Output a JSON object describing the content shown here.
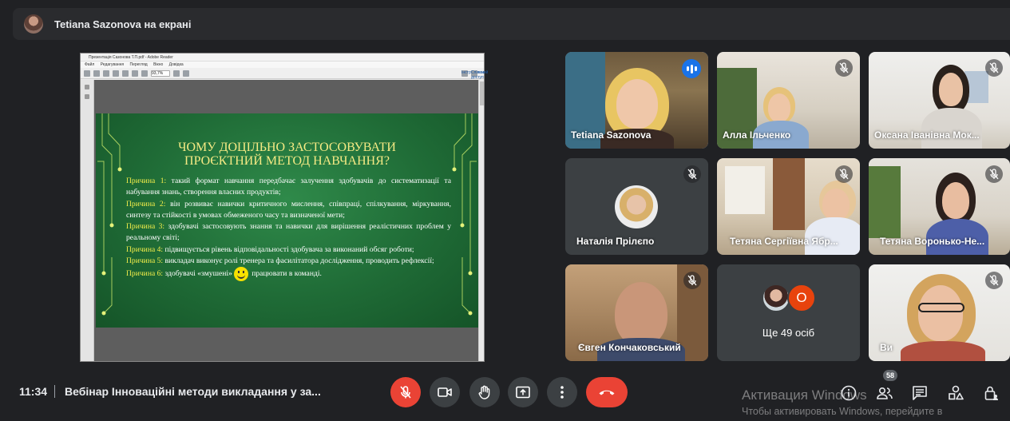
{
  "top_bar": {
    "presenter_title": "Tetiana Sazonova на екрані"
  },
  "shared_screen": {
    "window_title": "Презентація Сазонова Т.П.pdf - Adobe Reader",
    "menu": [
      "Файл",
      "Редагування",
      "Перегляд",
      "Вікно",
      "Довідка"
    ],
    "zoom": "93,7%",
    "toolbar_right": [
      "Інструменти",
      "Спільний доступ"
    ],
    "slide": {
      "title_line1": "ЧОМУ ДОЦІЛЬНО ЗАСТОСОВУВАТИ",
      "title_line2": "ПРОЄКТНИЙ МЕТОД НАВЧАННЯ?",
      "reasons": [
        {
          "label": "Причина 1:",
          "text": " такий формат навчання передбачає залучення здобувачів до систематизації та набування знань, створення власних продуктів;"
        },
        {
          "label": "Причина 2:",
          "text": " він розвиває навички критичного мислення, співпраці, спілкування, міркування, синтезу та стійкості в умовах обмеженого часу та визначеної мети;"
        },
        {
          "label": "Причина 3:",
          "text": " здобувачі застосовують знання та навички для вирішення реалістичних проблем у реальному світі;"
        },
        {
          "label": "Причина 4:",
          "text": " підвищується рівень відповідальності здобувача за виконаний обсяг роботи;"
        },
        {
          "label": "Причина 5:",
          "text": " викладач виконує ролі тренера та фасилітатора дослідження, проводить рефлексії;"
        },
        {
          "label": "Причина 6:",
          "text_before": " здобувачі «змушені»",
          "text_after": " працювати в команді."
        }
      ]
    }
  },
  "participants": [
    {
      "name": "Tetiana Sazonova",
      "speaking": true
    },
    {
      "name": "Алла Ільченко",
      "muted": true
    },
    {
      "name": "Оксана Іванівна Мок...",
      "muted": true
    },
    {
      "name": "Наталія Прілєпо",
      "muted": true
    },
    {
      "name": "Тетяна Сергіївна Ябр...",
      "muted": true
    },
    {
      "name": "Тетяна Воронько-Не...",
      "muted": true
    },
    {
      "name": "Євген Кончаковський",
      "muted": true
    },
    {
      "name": "Ви",
      "muted": true
    }
  ],
  "others": {
    "initial": "О",
    "label": "Ще 49 осіб"
  },
  "bottom_bar": {
    "time": "11:34",
    "meeting_title": "Вебінар Інноваційні методи викладання у за...",
    "participants_count": "58"
  },
  "watermark": {
    "line1": "Активация Windows",
    "line2": "Чтобы активировать Windows, перейдите в"
  },
  "colors": {
    "background": "#202124",
    "tile": "#3c4043",
    "danger": "#ea4335",
    "active": "#1a73e8",
    "slide_green": "#1f6b36",
    "slide_yellow": "#f3ee4a"
  }
}
